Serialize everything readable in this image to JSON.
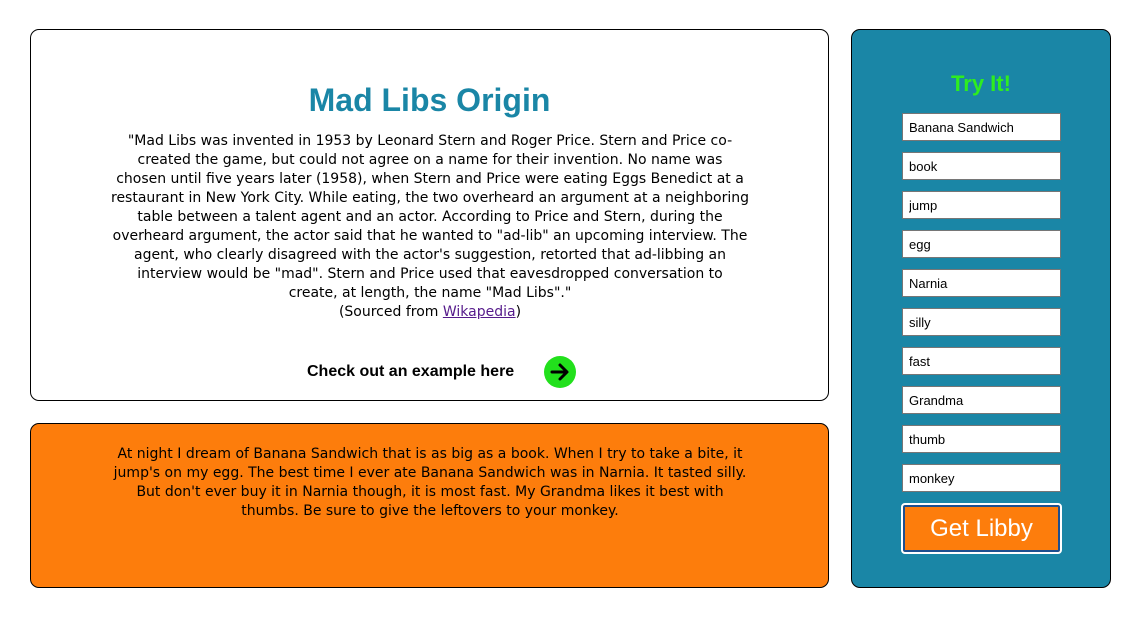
{
  "origin": {
    "title": "Mad Libs Origin",
    "quote": "\"Mad Libs was invented in 1953 by Leonard Stern and Roger Price. Stern and Price co-created the game, but could not agree on a name for their invention. No name was chosen until five years later (1958), when Stern and Price were eating Eggs Benedict at a restaurant in New York City. While eating, the two overheard an argument at a neighboring table between a talent agent and an actor. According to Price and Stern, during the overheard argument, the actor said that he wanted to \"ad-lib\" an upcoming interview. The agent, who clearly disagreed with the actor's suggestion, retorted that ad-libbing an interview would be \"mad\". Stern and Price used that eavesdropped conversation to create, at length, the name \"Mad Libs\".\"",
    "source_prefix": "(Sourced from ",
    "source_link": "Wikapedia",
    "source_suffix": ")",
    "example_label": "Check out an example here",
    "example_icon": "arrow-right-circle-icon"
  },
  "story": {
    "text": "At night I dream of Banana Sandwich that is as big as a book. When I try to take a bite, it jump's on my egg. The best time I ever ate Banana Sandwich was in Narnia. It tasted silly. But don't ever buy it in Narnia though, it is most fast. My Grandma likes it best with thumbs. Be sure to give the leftovers to your monkey."
  },
  "try_it": {
    "title": "Try It!",
    "inputs": [
      "Banana Sandwich",
      "book",
      "jump",
      "egg",
      "Narnia",
      "silly",
      "fast",
      "Grandma",
      "thumb",
      "monkey"
    ],
    "button_label": "Get Libby"
  },
  "colors": {
    "teal": "#1a86a6",
    "orange": "#fd7d0c",
    "green": "#2eed1f",
    "arrow_green": "#22e01c"
  }
}
